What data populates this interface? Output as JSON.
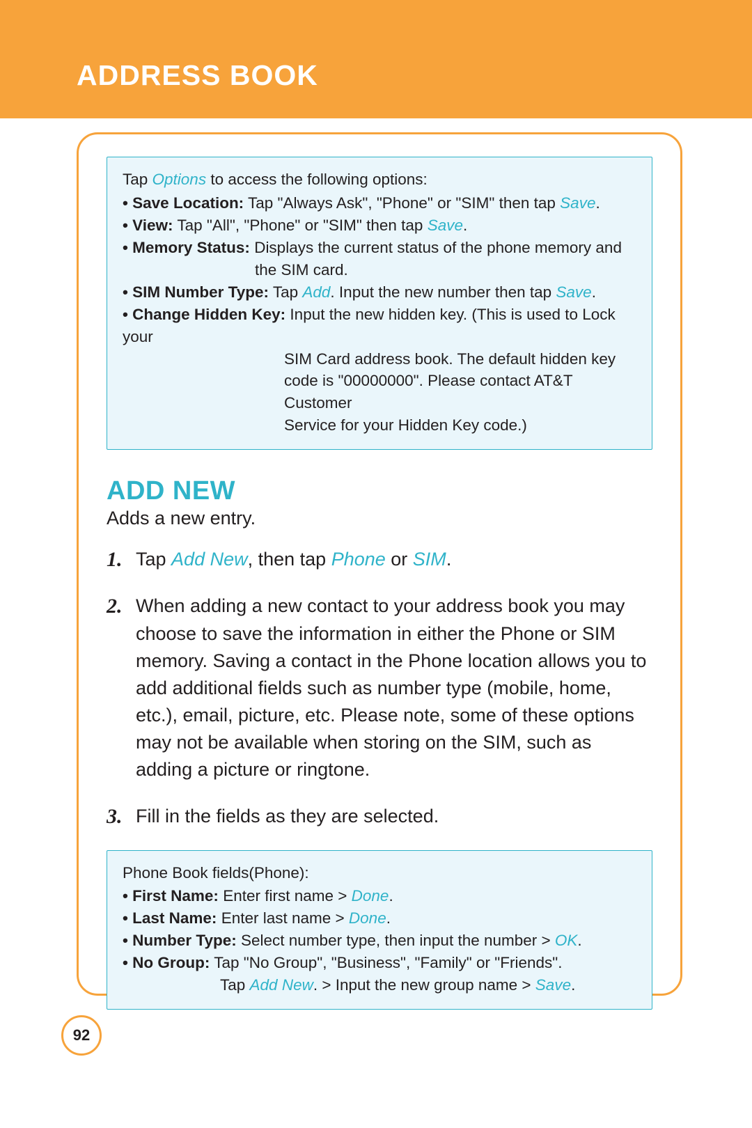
{
  "header": {
    "title": "ADDRESS BOOK"
  },
  "page_number": "92",
  "box1": {
    "lead_pre": "Tap ",
    "lead_mid": "Options",
    "lead_post": " to access the following options:",
    "items": [
      {
        "label": "Save Location:",
        "text_a": " Tap \"Always Ask\", \"Phone\" or \"SIM\" then tap ",
        "link": "Save",
        "text_b": "."
      },
      {
        "label": "View:",
        "text_a": " Tap \"All\", \"Phone\" or \"SIM\" then tap ",
        "link": "Save",
        "text_b": "."
      },
      {
        "label": "Memory Status:",
        "text_a": " Displays the current status of the phone memory and",
        "indent": "the SIM card."
      },
      {
        "label": "SIM Number Type:",
        "text_a": " Tap ",
        "link": "Add",
        "text_b": ". Input the new number then tap ",
        "link2": "Save",
        "text_c": "."
      },
      {
        "label": "Change Hidden Key:",
        "text_a": " Input the new hidden key. (This is used to Lock your",
        "indent_lines": [
          "SIM Card address book. The default hidden key",
          "code is \"00000000\". Please contact AT&T Customer",
          "Service for your Hidden Key code.)"
        ]
      }
    ]
  },
  "section": {
    "heading": "ADD NEW",
    "sub": "Adds a new entry.",
    "steps": {
      "s1": {
        "a": "Tap ",
        "l1": "Add New",
        "b": ", then tap ",
        "l2": "Phone",
        "c": " or ",
        "l3": "SIM",
        "d": "."
      },
      "s2": "When adding a new contact to your address book you may choose to save the information in either the Phone or SIM memory. Saving a contact in the Phone location allows you to add additional fields such as number type (mobile, home, etc.), email, picture, etc. Please note, some of these options may not be available when storing on the SIM, such as adding a picture or ringtone.",
      "s3": "Fill in the fields as they are selected."
    }
  },
  "box2": {
    "lead": "Phone Book fields(Phone):",
    "items": [
      {
        "label": "First Name:",
        "text_a": " Enter first name > ",
        "link": "Done",
        "text_b": "."
      },
      {
        "label": "Last Name:",
        "text_a": " Enter last name > ",
        "link": "Done",
        "text_b": "."
      },
      {
        "label": "Number Type:",
        "text_a": " Select number type, then input the number > ",
        "link": "OK",
        "text_b": "."
      },
      {
        "label": "No Group:",
        "text_a": " Tap \"No Group\", \"Business\", \"Family\" or \"Friends\".",
        "tail_a": "Tap ",
        "tail_link": "Add New",
        "tail_b": ". > Input the new group name > ",
        "tail_link2": "Save",
        "tail_c": "."
      }
    ]
  }
}
